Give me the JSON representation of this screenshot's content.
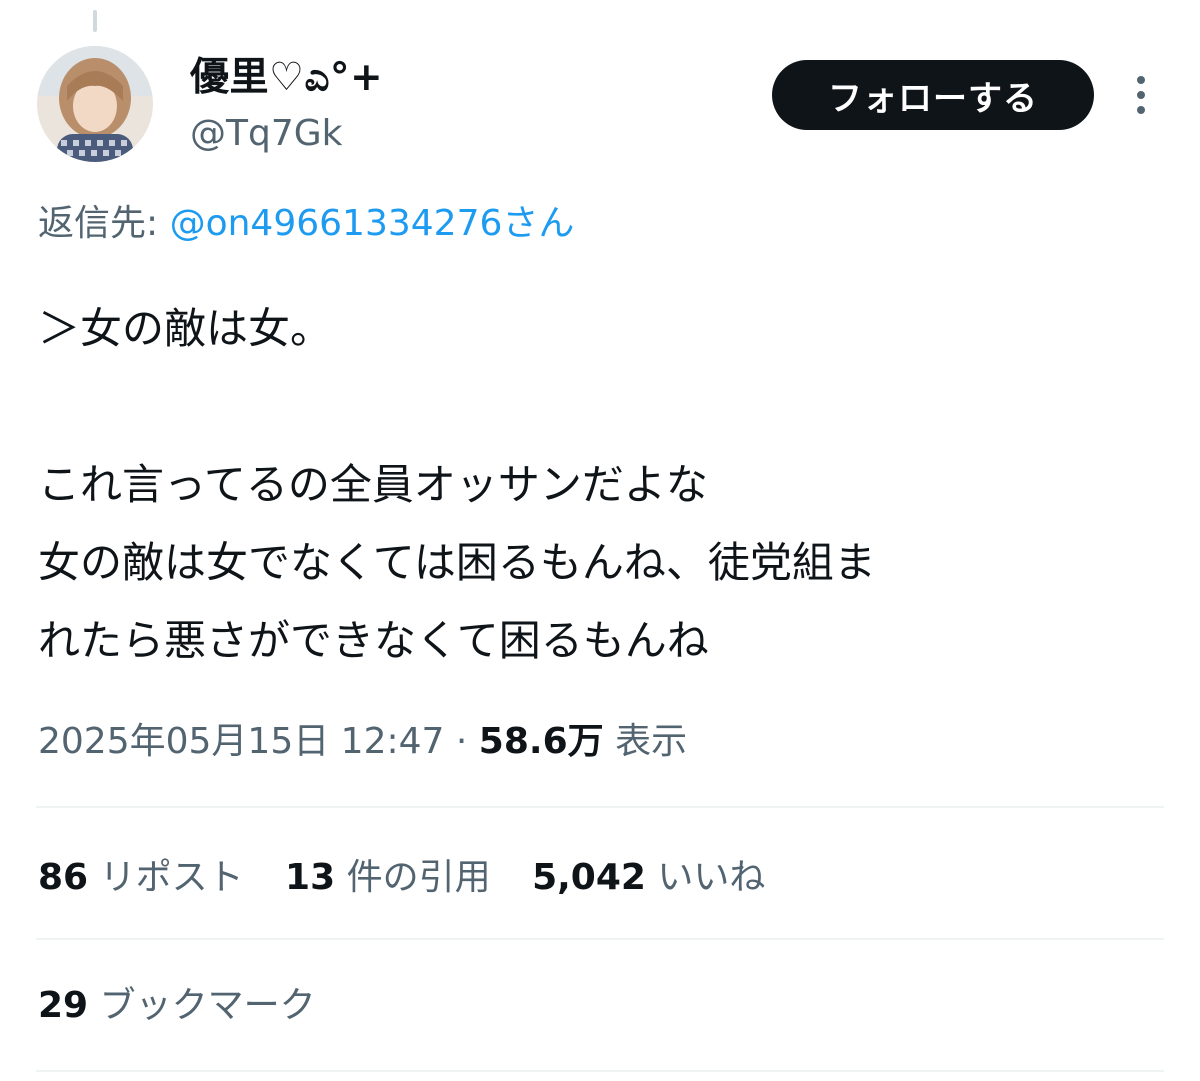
{
  "author": {
    "display_name": "優里♡ಎ°+",
    "handle": "@Tq7Gk",
    "avatar_icon": "profile-photo"
  },
  "follow_button": {
    "label": "フォローする"
  },
  "more_icon": "more-vertical-icon",
  "reply": {
    "label": "返信先:",
    "mention": "@on49661334276さん"
  },
  "tweet": {
    "lines": [
      "＞女の敵は女。",
      "",
      "これ言ってるの全員オッサンだよな",
      "女の敵は女でなくては困るもんね、徒党組ま",
      "れたら悪さができなくて困るもんね"
    ]
  },
  "meta": {
    "timestamp": "2025年05月15日 12:47",
    "separator": "·",
    "views_count": "58.6万",
    "views_label": "表示"
  },
  "stats": {
    "reposts": {
      "count": "86",
      "label": "リポスト"
    },
    "quotes": {
      "count": "13",
      "label": "件の引用"
    },
    "likes": {
      "count": "5,042",
      "label": "いいね"
    }
  },
  "bookmarks": {
    "count": "29",
    "label": "ブックマーク"
  },
  "colors": {
    "text": "#0f1419",
    "secondary": "#536471",
    "link": "#1d9bf0",
    "divider": "#eff3f4",
    "button_bg": "#0f1419"
  }
}
